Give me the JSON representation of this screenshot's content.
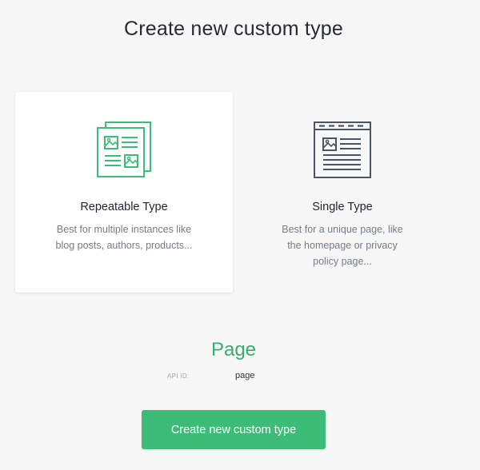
{
  "page": {
    "title": "Create new custom type"
  },
  "types": {
    "repeatable": {
      "name": "Repeatable Type",
      "description": "Best for multiple instances like blog posts, authors, products...",
      "icon": "repeatable-documents-icon",
      "selected": true,
      "accent_color": "#3dbc78"
    },
    "single": {
      "name": "Single Type",
      "description": "Best for a unique page, like the homepage or privacy policy page...",
      "icon": "browser-page-icon",
      "selected": false,
      "accent_color": "#4a5462"
    }
  },
  "custom_type": {
    "name": "Page",
    "api_id_label": "API ID:",
    "api_id_value": "page",
    "name_color": "#3aaa6e"
  },
  "actions": {
    "create_label": "Create new custom type",
    "button_color": "#3dbc78"
  }
}
